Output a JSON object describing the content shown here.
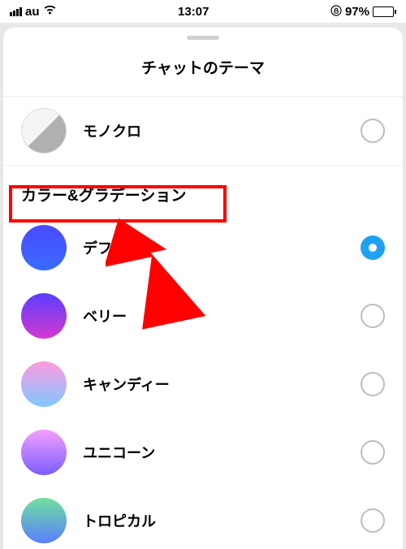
{
  "status": {
    "carrier": "au",
    "time": "13:07",
    "battery_pct": "97%"
  },
  "sheet": {
    "title": "チャットのテーマ",
    "section_color_gradient": "カラー&グラデーション"
  },
  "items": {
    "mono": {
      "label": "モノクロ",
      "selected": false
    },
    "default": {
      "label": "デフォ.",
      "selected": true
    },
    "berry": {
      "label": "ベリー",
      "selected": false
    },
    "candy": {
      "label": "キャンディー",
      "selected": false
    },
    "unicorn": {
      "label": "ユニコーン",
      "selected": false
    },
    "tropical": {
      "label": "トロピカル",
      "selected": false
    }
  },
  "colors": {
    "accent": "#1ea1f2",
    "highlight": "#ff0000"
  }
}
